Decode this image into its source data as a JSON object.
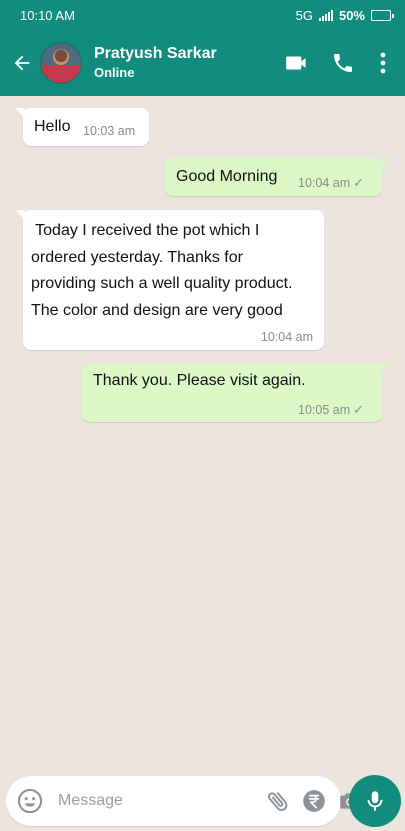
{
  "status_bar": {
    "time": "10:10 AM",
    "network": "5G",
    "battery": "50%"
  },
  "header": {
    "contact_name": "Pratyush Sarkar",
    "contact_status": "Online"
  },
  "messages": [
    {
      "direction": "incoming",
      "text": "Hello",
      "time": "10:03 am"
    },
    {
      "direction": "outgoing",
      "text": "Good Morning",
      "time": "10:04 am"
    },
    {
      "direction": "incoming",
      "lines": [
        " Today I received the pot which I",
        "ordered yesterday. Thanks for",
        "providing such a well quality product.",
        "The color and design are very good"
      ],
      "time": "10:04 am"
    },
    {
      "direction": "outgoing",
      "text": "Thank you. Please visit again.",
      "time": "10:05 am"
    }
  ],
  "composer": {
    "placeholder": "Message",
    "value": ""
  },
  "colors": {
    "brand": "#128c7e",
    "background": "#ece5dd",
    "outgoing_bubble": "#dcf8c6",
    "incoming_bubble": "#ffffff"
  },
  "icons": [
    "back-arrow-icon",
    "video-call-icon",
    "phone-icon",
    "more-vert-icon",
    "emoji-icon",
    "attach-icon",
    "rupee-icon",
    "camera-icon",
    "mic-icon"
  ]
}
